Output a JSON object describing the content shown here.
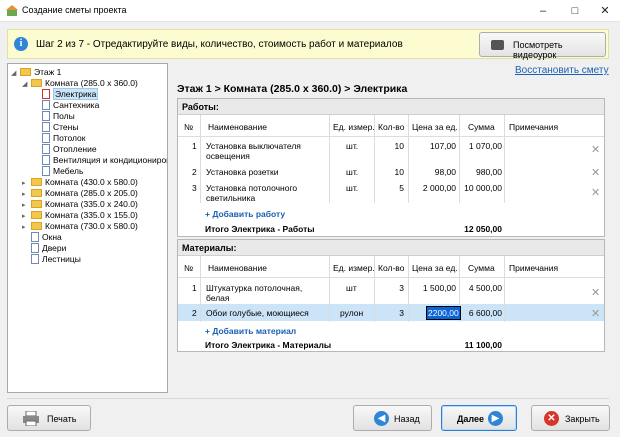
{
  "window": {
    "title": "Создание сметы проекта"
  },
  "step": {
    "text": "Шаг 2 из 7 - Отредактируйте виды, количество, стоимость работ и материалов",
    "video_button": "Посмотреть видеоурок"
  },
  "tree": {
    "root": "Этаж 1",
    "room1": "Комната (285.0 x 360.0)",
    "items": [
      "Электрика",
      "Сантехника",
      "Полы",
      "Стены",
      "Потолок",
      "Отопление",
      "Вентиляция и кондиционирование",
      "Мебель"
    ],
    "rooms": [
      "Комната (430.0 x 580.0)",
      "Комната (285.0 x 205.0)",
      "Комната (335.0 x 240.0)",
      "Комната (335.0 x 155.0)",
      "Комната (730.0 x 580.0)"
    ],
    "others": [
      "Окна",
      "Двери",
      "Лестницы"
    ]
  },
  "restore_link": "Восстановить смету",
  "breadcrumb": "Этаж 1 > Комната (285.0 x 360.0) > Электрика",
  "columns": {
    "num": "№",
    "name": "Наименование",
    "unit": "Ед. измер.",
    "qty": "Кол-во",
    "price": "Цена за ед.",
    "sum": "Сумма",
    "notes": "Примечания"
  },
  "works": {
    "header": "Работы:",
    "rows": [
      {
        "num": "1",
        "name": "Установка выключателя освещения",
        "unit": "шт.",
        "qty": "10",
        "price": "107,00",
        "sum": "1 070,00"
      },
      {
        "num": "2",
        "name": "Установка розетки",
        "unit": "шт.",
        "qty": "10",
        "price": "98,00",
        "sum": "980,00"
      },
      {
        "num": "3",
        "name": "Установка потолочного светильника",
        "unit": "шт.",
        "qty": "5",
        "price": "2 000,00",
        "sum": "10 000,00"
      }
    ],
    "add": "+ Добавить работу",
    "total_label": "Итого Электрика - Работы",
    "total_value": "12 050,00"
  },
  "materials": {
    "header": "Материалы:",
    "rows": [
      {
        "num": "1",
        "name": "Штукатурка потолочная, белая",
        "unit": "шт",
        "qty": "3",
        "price": "1 500,00",
        "sum": "4 500,00"
      },
      {
        "num": "2",
        "name": "Обои голубые, моющиеся",
        "unit": "рулон",
        "qty": "3",
        "price": "2200,00",
        "sum": "6 600,00"
      }
    ],
    "add": "+ Добавить материал",
    "total_label": "Итого Электрика - Материалы",
    "total_value": "11 100,00"
  },
  "buttons": {
    "print": "Печать",
    "back": "Назад",
    "next": "Далее",
    "close": "Закрыть"
  },
  "colors": {
    "accent": "#1a5fb4",
    "selection": "#cce4f7",
    "step_bg": "#fcfcd0"
  }
}
